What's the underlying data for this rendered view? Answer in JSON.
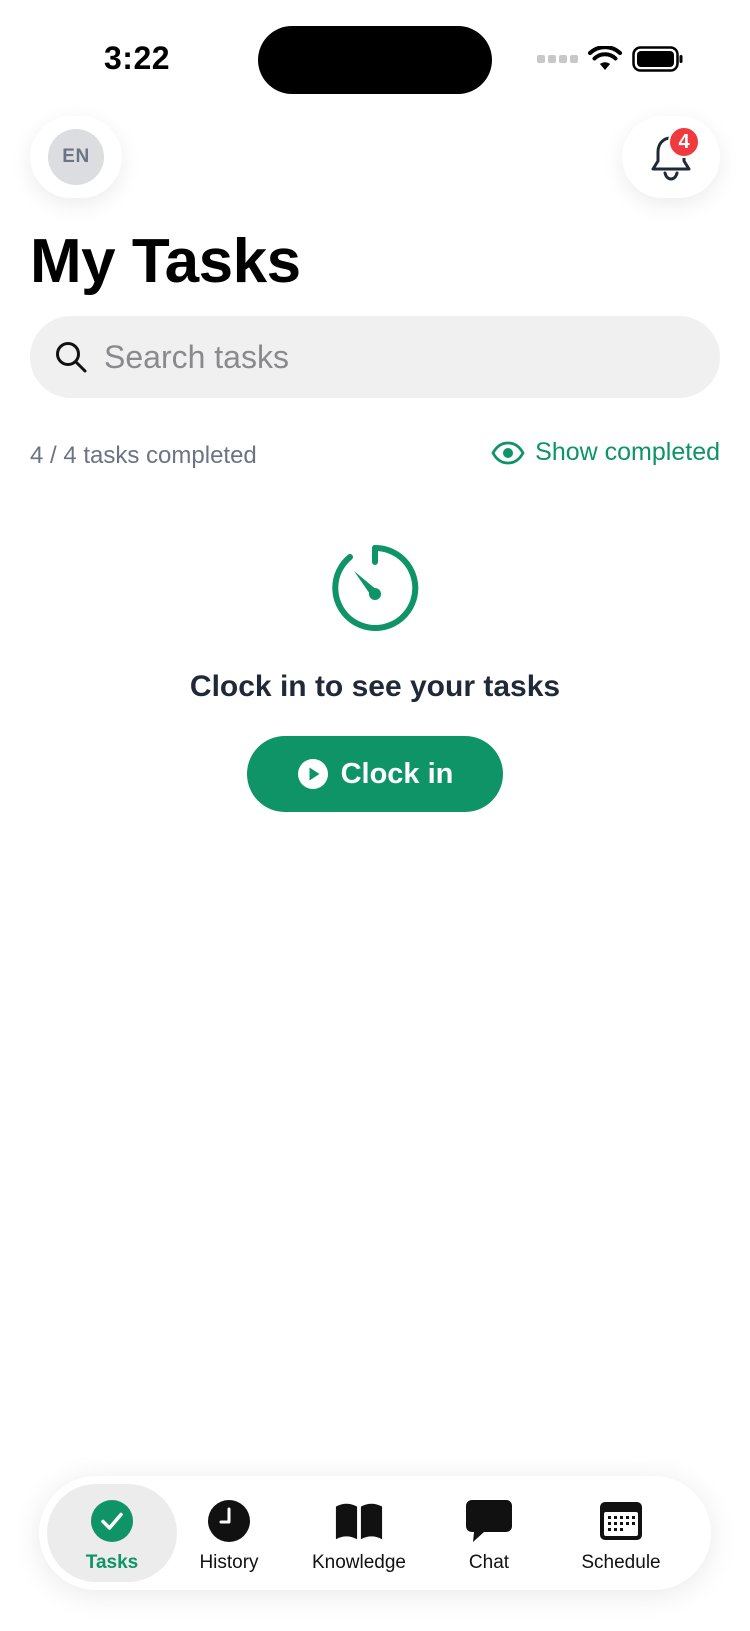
{
  "status_bar": {
    "time": "3:22"
  },
  "header": {
    "language_code": "EN",
    "notification_count": "4"
  },
  "page": {
    "title": "My Tasks"
  },
  "search": {
    "placeholder": "Search tasks",
    "value": ""
  },
  "progress": {
    "summary": "4 / 4 tasks completed",
    "show_completed_label": "Show completed"
  },
  "empty_state": {
    "message": "Clock in to see your tasks",
    "button_label": "Clock in"
  },
  "bottom_nav": {
    "items": [
      {
        "label": "Tasks",
        "icon": "check-circle-icon",
        "active": true
      },
      {
        "label": "History",
        "icon": "clock-icon",
        "active": false
      },
      {
        "label": "Knowledge",
        "icon": "book-icon",
        "active": false
      },
      {
        "label": "Chat",
        "icon": "chat-bubble-icon",
        "active": false
      },
      {
        "label": "Schedule",
        "icon": "calendar-icon",
        "active": false
      }
    ]
  },
  "colors": {
    "accent": "#0e9466",
    "badge": "#f03a3f",
    "muted_text": "#6b7385"
  }
}
